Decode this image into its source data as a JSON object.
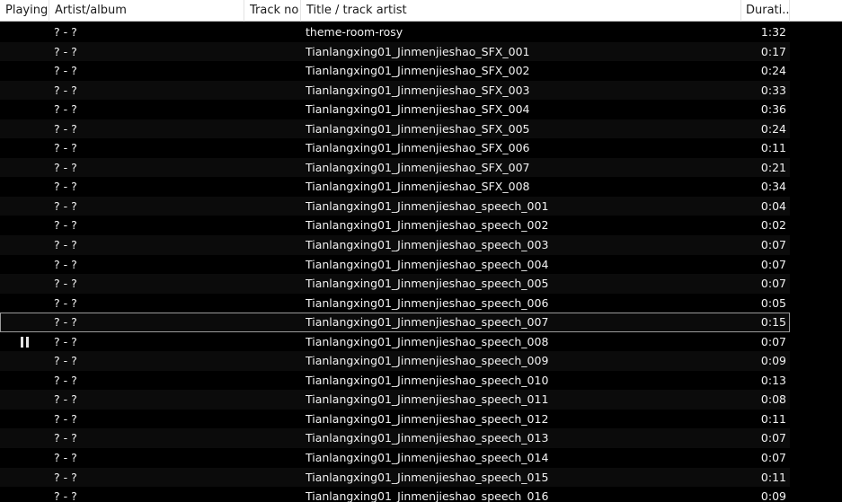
{
  "columns": {
    "playing": "Playing",
    "artist_album": "Artist/album",
    "track_no": "Track no",
    "title_artist": "Title / track artist",
    "duration": "Durati..."
  },
  "tracks": [
    {
      "artist_album": "? - ?",
      "track_no": "",
      "title": "theme-room-rosy",
      "duration": "1:32"
    },
    {
      "artist_album": "? - ?",
      "track_no": "",
      "title": "Tianlangxing01_Jinmenjieshao_SFX_001",
      "duration": "0:17"
    },
    {
      "artist_album": "? - ?",
      "track_no": "",
      "title": "Tianlangxing01_Jinmenjieshao_SFX_002",
      "duration": "0:24"
    },
    {
      "artist_album": "? - ?",
      "track_no": "",
      "title": "Tianlangxing01_Jinmenjieshao_SFX_003",
      "duration": "0:33"
    },
    {
      "artist_album": "? - ?",
      "track_no": "",
      "title": "Tianlangxing01_Jinmenjieshao_SFX_004",
      "duration": "0:36"
    },
    {
      "artist_album": "? - ?",
      "track_no": "",
      "title": "Tianlangxing01_Jinmenjieshao_SFX_005",
      "duration": "0:24"
    },
    {
      "artist_album": "? - ?",
      "track_no": "",
      "title": "Tianlangxing01_Jinmenjieshao_SFX_006",
      "duration": "0:11"
    },
    {
      "artist_album": "? - ?",
      "track_no": "",
      "title": "Tianlangxing01_Jinmenjieshao_SFX_007",
      "duration": "0:21"
    },
    {
      "artist_album": "? - ?",
      "track_no": "",
      "title": "Tianlangxing01_Jinmenjieshao_SFX_008",
      "duration": "0:34"
    },
    {
      "artist_album": "? - ?",
      "track_no": "",
      "title": "Tianlangxing01_Jinmenjieshao_speech_001",
      "duration": "0:04"
    },
    {
      "artist_album": "? - ?",
      "track_no": "",
      "title": "Tianlangxing01_Jinmenjieshao_speech_002",
      "duration": "0:02"
    },
    {
      "artist_album": "? - ?",
      "track_no": "",
      "title": "Tianlangxing01_Jinmenjieshao_speech_003",
      "duration": "0:07"
    },
    {
      "artist_album": "? - ?",
      "track_no": "",
      "title": "Tianlangxing01_Jinmenjieshao_speech_004",
      "duration": "0:07"
    },
    {
      "artist_album": "? - ?",
      "track_no": "",
      "title": "Tianlangxing01_Jinmenjieshao_speech_005",
      "duration": "0:07"
    },
    {
      "artist_album": "? - ?",
      "track_no": "",
      "title": "Tianlangxing01_Jinmenjieshao_speech_006",
      "duration": "0:05"
    },
    {
      "artist_album": "? - ?",
      "track_no": "",
      "title": "Tianlangxing01_Jinmenjieshao_speech_007",
      "duration": "0:15"
    },
    {
      "artist_album": "? - ?",
      "track_no": "",
      "title": "Tianlangxing01_Jinmenjieshao_speech_008",
      "duration": "0:07"
    },
    {
      "artist_album": "? - ?",
      "track_no": "",
      "title": "Tianlangxing01_Jinmenjieshao_speech_009",
      "duration": "0:09"
    },
    {
      "artist_album": "? - ?",
      "track_no": "",
      "title": "Tianlangxing01_Jinmenjieshao_speech_010",
      "duration": "0:13"
    },
    {
      "artist_album": "? - ?",
      "track_no": "",
      "title": "Tianlangxing01_Jinmenjieshao_speech_011",
      "duration": "0:08"
    },
    {
      "artist_album": "? - ?",
      "track_no": "",
      "title": "Tianlangxing01_Jinmenjieshao_speech_012",
      "duration": "0:11"
    },
    {
      "artist_album": "? - ?",
      "track_no": "",
      "title": "Tianlangxing01_Jinmenjieshao_speech_013",
      "duration": "0:07"
    },
    {
      "artist_album": "? - ?",
      "track_no": "",
      "title": "Tianlangxing01_Jinmenjieshao_speech_014",
      "duration": "0:07"
    },
    {
      "artist_album": "? - ?",
      "track_no": "",
      "title": "Tianlangxing01_Jinmenjieshao_speech_015",
      "duration": "0:11"
    },
    {
      "artist_album": "? - ?",
      "track_no": "",
      "title": "Tianlangxing01_Jinmenjieshao_speech_016",
      "duration": "0:09"
    }
  ],
  "focused_track_index": 15,
  "playing_track_index": 16,
  "playing_state_icon": "pause-icon",
  "colors": {
    "background": "#000000",
    "text": "#f2f2f2",
    "header_background": "#ffffff",
    "header_text": "#1a1a1a",
    "focus_outline": "#9a9a9a"
  }
}
